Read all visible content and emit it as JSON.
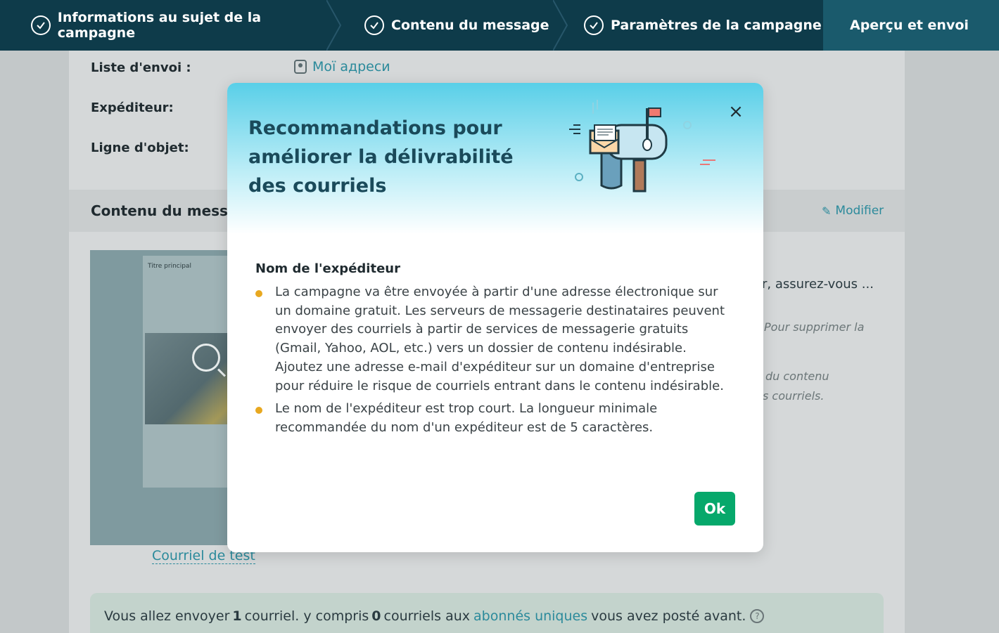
{
  "stepper": {
    "steps": [
      {
        "label": "Informations au sujet de la campagne",
        "done": true
      },
      {
        "label": "Contenu du message",
        "done": true
      },
      {
        "label": "Paramètres de la campagne",
        "done": true
      },
      {
        "label": "Aperçu et envoi",
        "done": false,
        "active": true
      }
    ]
  },
  "summary": {
    "list_label": "Liste d'envoi :",
    "list_value": "Мої адреси",
    "sender_label": "Expéditeur:",
    "subject_label": "Ligne d'objet:",
    "content_heading": "Contenu du message",
    "edit_label": "Modifier",
    "test_email_link": "Courriel de test",
    "preview_title": "Titre principal",
    "side_text_1": "r, assurez-vous ...",
    "side_text_2": "Pour supprimer la",
    "side_text_3": "du contenu",
    "side_text_4": "s courriels."
  },
  "bottom_bar": {
    "text_1": "Vous allez envoyer",
    "count_1": "1",
    "text_2": "courriel.  y compris",
    "count_2": "0",
    "text_3": "courriels aux",
    "link": "abonnés uniques",
    "text_4": "vous avez posté avant."
  },
  "modal": {
    "title": "Recommandations pour améliorer la délivrabilité des courriels",
    "section_title": "Nom de l'expéditeur",
    "items": [
      "La campagne va être envoyée à partir d'une adresse électronique sur un domaine gratuit. Les serveurs de messagerie destinataires peuvent envoyer des courriels à partir de services de messagerie gratuits (Gmail, Yahoo, AOL, etc.) vers un dossier de contenu indésirable. Ajoutez une adresse e-mail d'expéditeur sur un domaine d'entreprise pour réduire le risque de courriels entrant dans le contenu indésirable.",
      "Le nom de l'expéditeur est trop court. La longueur minimale recommandée du nom d'un expéditeur est de 5 caractères."
    ],
    "ok_label": "Ok",
    "close_label": "×"
  },
  "colors": {
    "stepper_bg": "#0e3b4a",
    "accent_green": "#06a86b",
    "bullet": "#e8a820",
    "link": "#2b8a9b"
  }
}
